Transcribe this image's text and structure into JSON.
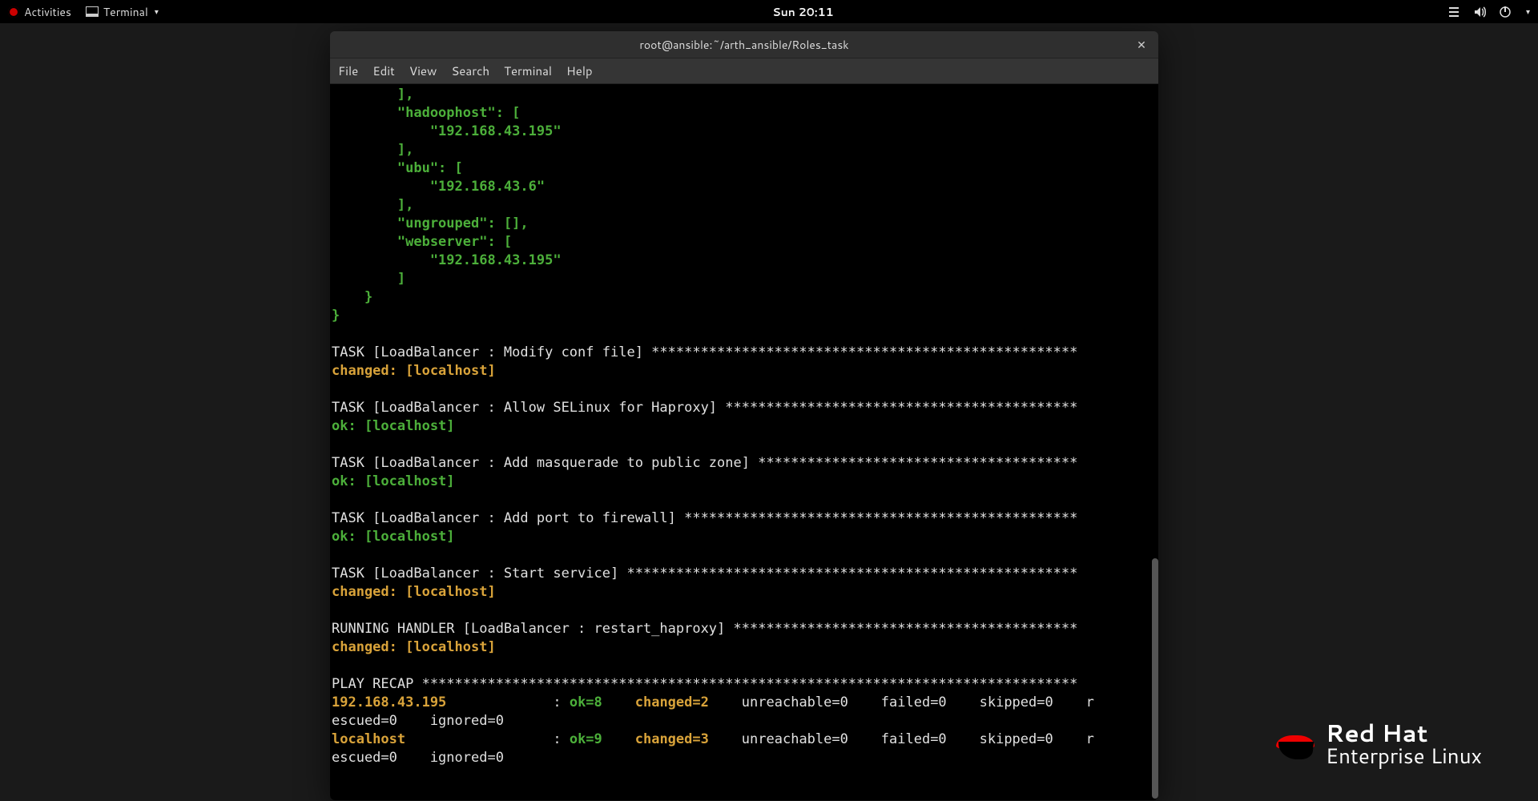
{
  "topbar": {
    "activities": "Activities",
    "app": "Terminal",
    "clock": "Sun 20:11"
  },
  "brand": {
    "line1": "Red Hat",
    "line2": "Enterprise Linux"
  },
  "window": {
    "title": "root@ansible:~/arth_ansible/Roles_task",
    "menu": {
      "file": "File",
      "edit": "Edit",
      "view": "View",
      "search": "Search",
      "terminal": "Terminal",
      "help": "Help"
    }
  },
  "terminal": {
    "json_lines": [
      "        ],",
      "        \"hadoophost\": [",
      "            \"192.168.43.195\"",
      "        ],",
      "        \"ubu\": [",
      "            \"192.168.43.6\"",
      "        ],",
      "        \"ungrouped\": [],",
      "        \"webserver\": [",
      "            \"192.168.43.195\"",
      "        ]",
      "    }",
      "}"
    ],
    "tasks": [
      {
        "header": "TASK [LoadBalancer : Modify conf file] ****************************************************",
        "status": "changed",
        "host": "[localhost]"
      },
      {
        "header": "TASK [LoadBalancer : Allow SELinux for Haproxy] *******************************************",
        "status": "ok",
        "host": "[localhost]"
      },
      {
        "header": "TASK [LoadBalancer : Add masquerade to public zone] ***************************************",
        "status": "ok",
        "host": "[localhost]"
      },
      {
        "header": "TASK [LoadBalancer : Add port to firewall] ************************************************",
        "status": "ok",
        "host": "[localhost]"
      },
      {
        "header": "TASK [LoadBalancer : Start service] *******************************************************",
        "status": "changed",
        "host": "[localhost]"
      },
      {
        "header": "RUNNING HANDLER [LoadBalancer : restart_haproxy] ******************************************",
        "status": "changed",
        "host": "[localhost]"
      }
    ],
    "recap_header": "PLAY RECAP ********************************************************************************",
    "recap": [
      {
        "host": "192.168.43.195",
        "ok": "ok=8",
        "changed": "changed=2",
        "rest1": "unreachable=0    failed=0    skipped=0    r",
        "rest2": "escued=0    ignored=0"
      },
      {
        "host": "localhost",
        "ok": "ok=9",
        "changed": "changed=3",
        "rest1": "unreachable=0    failed=0    skipped=0    r",
        "rest2": "escued=0    ignored=0"
      }
    ]
  }
}
